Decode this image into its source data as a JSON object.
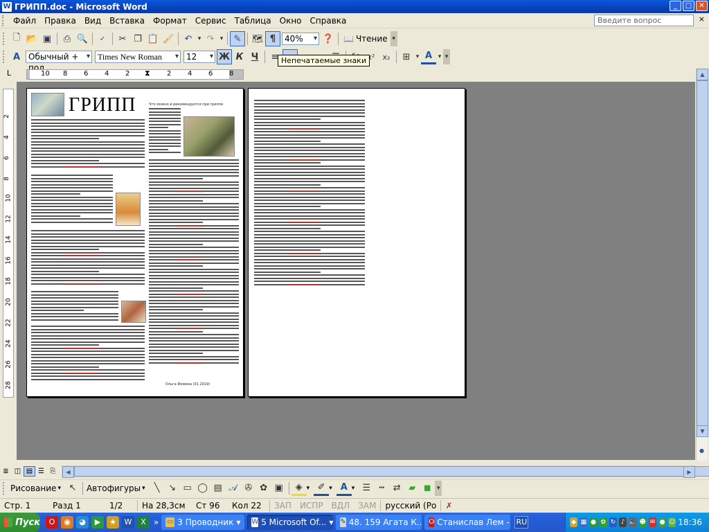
{
  "window": {
    "title": "ГРИПП.doc - Microsoft Word",
    "app_icon": "word-icon",
    "buttons": [
      "_",
      "□",
      "✕"
    ]
  },
  "menu": {
    "items": [
      "Файл",
      "Правка",
      "Вид",
      "Вставка",
      "Формат",
      "Сервис",
      "Таблица",
      "Окно",
      "Справка"
    ],
    "help_placeholder": "Введите вопрос",
    "close": "×"
  },
  "toolbar_standard": {
    "zoom": "40%",
    "reading_label": "Чтение",
    "icons": [
      "new-icon",
      "open-icon",
      "save-icon",
      "print-icon",
      "print-preview-icon",
      "spelling-icon",
      "cut-icon",
      "copy-icon",
      "paste-icon",
      "format-painter-icon",
      "undo-icon",
      "redo-icon",
      "drawing-icon",
      "document-map-icon",
      "show-formatting-icon",
      "help-icon",
      "reading-icon"
    ]
  },
  "toolbar_format": {
    "style": "Обычный + пол",
    "font": "Times New Roman",
    "size": "12",
    "bold": "Ж",
    "italic": "К",
    "underline": "Ч",
    "font_color_letter": "A"
  },
  "tooltip": "Непечатаемые знаки",
  "ruler": {
    "corner": "L",
    "h_numbers": [
      "10",
      "8",
      "6",
      "4",
      "2",
      "2",
      "4",
      "6",
      "8"
    ],
    "v_numbers": [
      "2",
      "4",
      "6",
      "8",
      "10",
      "12",
      "14",
      "16",
      "18",
      "20",
      "22",
      "24",
      "26",
      "28"
    ]
  },
  "document": {
    "page1": {
      "title": "ГРИПП",
      "caption": "Что можно и рекомендуется при гриппе",
      "credit": "Ольга Фомина (01.2019)"
    }
  },
  "drawing_toolbar": {
    "draw_label": "Рисование",
    "autoshapes_label": "Автофигуры"
  },
  "status_bar": {
    "page": "Стр. 1",
    "section": "Разд 1",
    "pages": "1/2",
    "at": "На 28,3см",
    "line": "Ст 96",
    "col": "Кол 22",
    "rec": "ЗАП",
    "trk": "ИСПР",
    "ext": "ВДЛ",
    "ovr": "ЗАМ",
    "language": "русский (Ро"
  },
  "taskbar": {
    "start": "Пуск",
    "quicklaunch_more": "»",
    "tasks": [
      {
        "label": "3 Проводник",
        "icon": "folder-icon",
        "dropdown": "▾",
        "active": false
      },
      {
        "label": "5 Microsoft Of...",
        "icon": "word-icon",
        "dropdown": "▾",
        "active": true
      },
      {
        "label": "48. 159 Агата К...",
        "icon": "pen-icon",
        "active": false
      },
      {
        "label": "Станислав Лем -...",
        "icon": "opera-icon",
        "active": false
      }
    ],
    "language": "RU",
    "time": "18:36"
  },
  "colors": {
    "titlebar": "#0a58e0",
    "chrome": "#ece9d8",
    "doc_background": "#808080",
    "taskbar": "#245edb",
    "start_green": "#2e8b2e",
    "tray": "#0c82d6"
  }
}
